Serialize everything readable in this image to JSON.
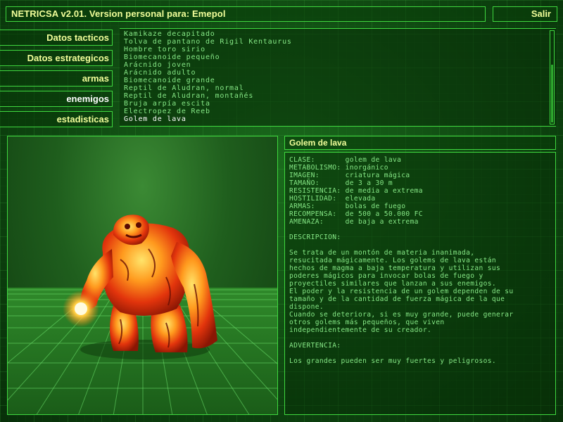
{
  "header": {
    "title": "NETRICSA v2.01. Version personal para: Emepol",
    "exit_label": "Salir"
  },
  "nav": {
    "items": [
      {
        "label": "Datos tacticos",
        "active": false
      },
      {
        "label": "Datos estrategicos",
        "active": false
      },
      {
        "label": "armas",
        "active": false
      },
      {
        "label": "enemigos",
        "active": true
      },
      {
        "label": "estadisticas",
        "active": false
      }
    ]
  },
  "enemy_list": {
    "items": [
      "Kamikaze decapitado",
      "Tolva de pantano de Rigil Kentaurus",
      "Hombre toro sirio",
      "Biomecanoide pequeño",
      "Arácnido joven",
      "Arácnido adulto",
      "Biomecanoide grande",
      "Reptil de Aludran, normal",
      "Reptil de Aludran, montañés",
      "Bruja arpía escita",
      "Electropez de Reeb",
      "Golem de lava"
    ],
    "selected": "Golem de lava"
  },
  "detail": {
    "name": "Golem de lava",
    "text": "CLASE:       golem de lava\nMETABOLISMO: inorgánico\nIMAGEN:      criatura mágica\nTAMAÑO:      de 3 a 30 m\nRESISTENCIA: de media a extrema\nHOSTILIDAD:  elevada\nARMAS:       bolas de fuego\nRECOMPENSA:  de 500 a 50.000 FC\nAMENAZA:     de baja a extrema\n\nDESCRIPCION:\n\nSe trata de un montón de materia inanimada,\nresucitada mágicamente. Los golems de lava están\nhechos de magma a baja temperatura y utilizan sus\npoderes mágicos para invocar bolas de fuego y\nproyectiles similares que lanzan a sus enemigos.\nEl poder y la resistencia de un golem dependen de su\ntamaño y de la cantidad de fuerza mágica de la que\ndispone.\nCuando se deteriora, si es muy grande, puede generar\notros golems más pequeños, que viven\nindependientemente de su creador.\n\nADVERTENCIA:\n\nLos grandes pueden ser muy fuertes y peligrosos."
  },
  "colors": {
    "accent_border": "#3fd83f",
    "label_yellow": "#f2ff9a",
    "text_green": "#86e886",
    "selected_white": "#ffffff"
  }
}
